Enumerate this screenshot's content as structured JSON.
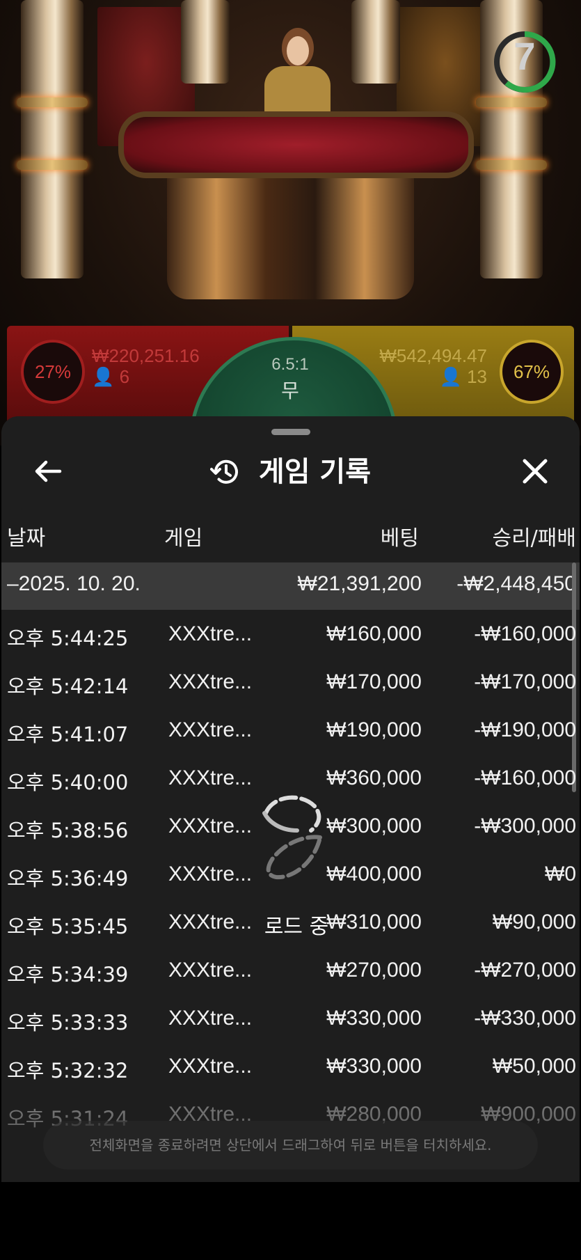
{
  "video": {
    "timer": "7",
    "red_bet": {
      "percent": "27%",
      "amount": "₩220,251.16",
      "players": "6"
    },
    "gold_bet": {
      "percent": "67%",
      "amount": "₩542,494.47",
      "players": "13"
    },
    "tie": {
      "odds": "6.5:1",
      "label": "무"
    }
  },
  "sheet": {
    "title": "게임 기록",
    "columns": {
      "date": "날짜",
      "game": "게임",
      "bet": "베팅",
      "winloss": "승리/패배"
    },
    "date_row": {
      "date": "–2025. 10. 20.",
      "bet": "₩21,391,200",
      "winloss": "-₩2,448,450"
    },
    "rows": [
      {
        "time": "오후 5:44:25",
        "game": "XXXtre...",
        "bet": "₩160,000",
        "winloss": "-₩160,000"
      },
      {
        "time": "오후 5:42:14",
        "game": "XXXtre...",
        "bet": "₩170,000",
        "winloss": "-₩170,000"
      },
      {
        "time": "오후 5:41:07",
        "game": "XXXtre...",
        "bet": "₩190,000",
        "winloss": "-₩190,000"
      },
      {
        "time": "오후 5:40:00",
        "game": "XXXtre...",
        "bet": "₩360,000",
        "winloss": "-₩160,000"
      },
      {
        "time": "오후 5:38:56",
        "game": "XXXtre...",
        "bet": "₩300,000",
        "winloss": "-₩300,000"
      },
      {
        "time": "오후 5:36:49",
        "game": "XXXtre...",
        "bet": "₩400,000",
        "winloss": "₩0"
      },
      {
        "time": "오후 5:35:45",
        "game": "XXXtre...",
        "bet": "₩310,000",
        "winloss": "₩90,000"
      },
      {
        "time": "오후 5:34:39",
        "game": "XXXtre...",
        "bet": "₩270,000",
        "winloss": "-₩270,000"
      },
      {
        "time": "오후 5:33:33",
        "game": "XXXtre...",
        "bet": "₩330,000",
        "winloss": "-₩330,000"
      },
      {
        "time": "오후 5:32:32",
        "game": "XXXtre...",
        "bet": "₩330,000",
        "winloss": "₩50,000"
      },
      {
        "time": "오후 5:31:24",
        "game": "XXXtre...",
        "bet": "₩280,000",
        "winloss": "₩900,000"
      }
    ],
    "loading": "로드 중",
    "toast": "전체화면을 종료하려면 상단에서 드래그하여 뒤로 버튼을 터치하세요."
  }
}
